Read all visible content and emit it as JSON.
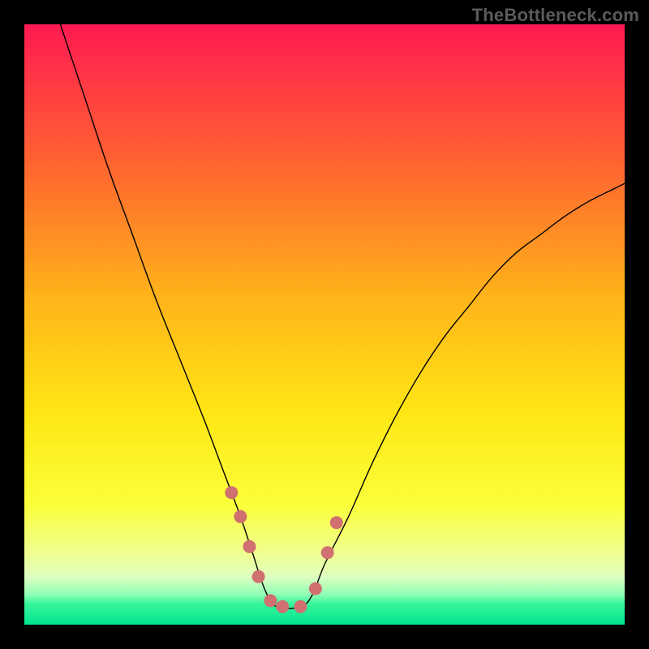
{
  "watermark": "TheBottleneck.com",
  "chart_data": {
    "type": "line",
    "title": "",
    "xlabel": "",
    "ylabel": "",
    "xlim": [
      0,
      100
    ],
    "ylim": [
      0,
      100
    ],
    "grid": false,
    "series": [
      {
        "name": "curve",
        "stroke": "#000000",
        "stroke_width": 1.4,
        "x": [
          6,
          10,
          14,
          18,
          22,
          26,
          30,
          33,
          36,
          38,
          40,
          42,
          46,
          48,
          50,
          54,
          58,
          62,
          66,
          70,
          74,
          78,
          82,
          86,
          90,
          94,
          98,
          100
        ],
        "y": [
          100,
          88,
          76,
          65,
          54,
          44,
          34,
          26,
          18,
          12,
          6,
          3,
          3,
          5,
          10,
          18,
          27,
          35,
          42,
          48,
          53,
          58,
          62,
          65,
          68,
          70.5,
          72.5,
          73.5
        ]
      },
      {
        "name": "markers",
        "type": "scatter",
        "stroke": "#d07070",
        "fill": "#d07070",
        "radius": 8,
        "x": [
          34.5,
          36,
          37.5,
          39,
          41,
          43,
          46,
          48.5,
          50.5,
          52
        ],
        "y": [
          22,
          18,
          13,
          8,
          4,
          3,
          3,
          6,
          12,
          17
        ]
      }
    ],
    "background_gradient": {
      "stops": [
        {
          "offset": 0.0,
          "color": "#ff1a52"
        },
        {
          "offset": 0.25,
          "color": "#ff6a2e"
        },
        {
          "offset": 0.45,
          "color": "#ffb21a"
        },
        {
          "offset": 0.65,
          "color": "#ffe714"
        },
        {
          "offset": 0.8,
          "color": "#fbff3a"
        },
        {
          "offset": 0.88,
          "color": "#f0ff8f"
        },
        {
          "offset": 0.92,
          "color": "#dfffc0"
        },
        {
          "offset": 0.95,
          "color": "#8fffb5"
        },
        {
          "offset": 0.965,
          "color": "#37f59b"
        },
        {
          "offset": 1.0,
          "color": "#00e58e"
        }
      ]
    }
  }
}
